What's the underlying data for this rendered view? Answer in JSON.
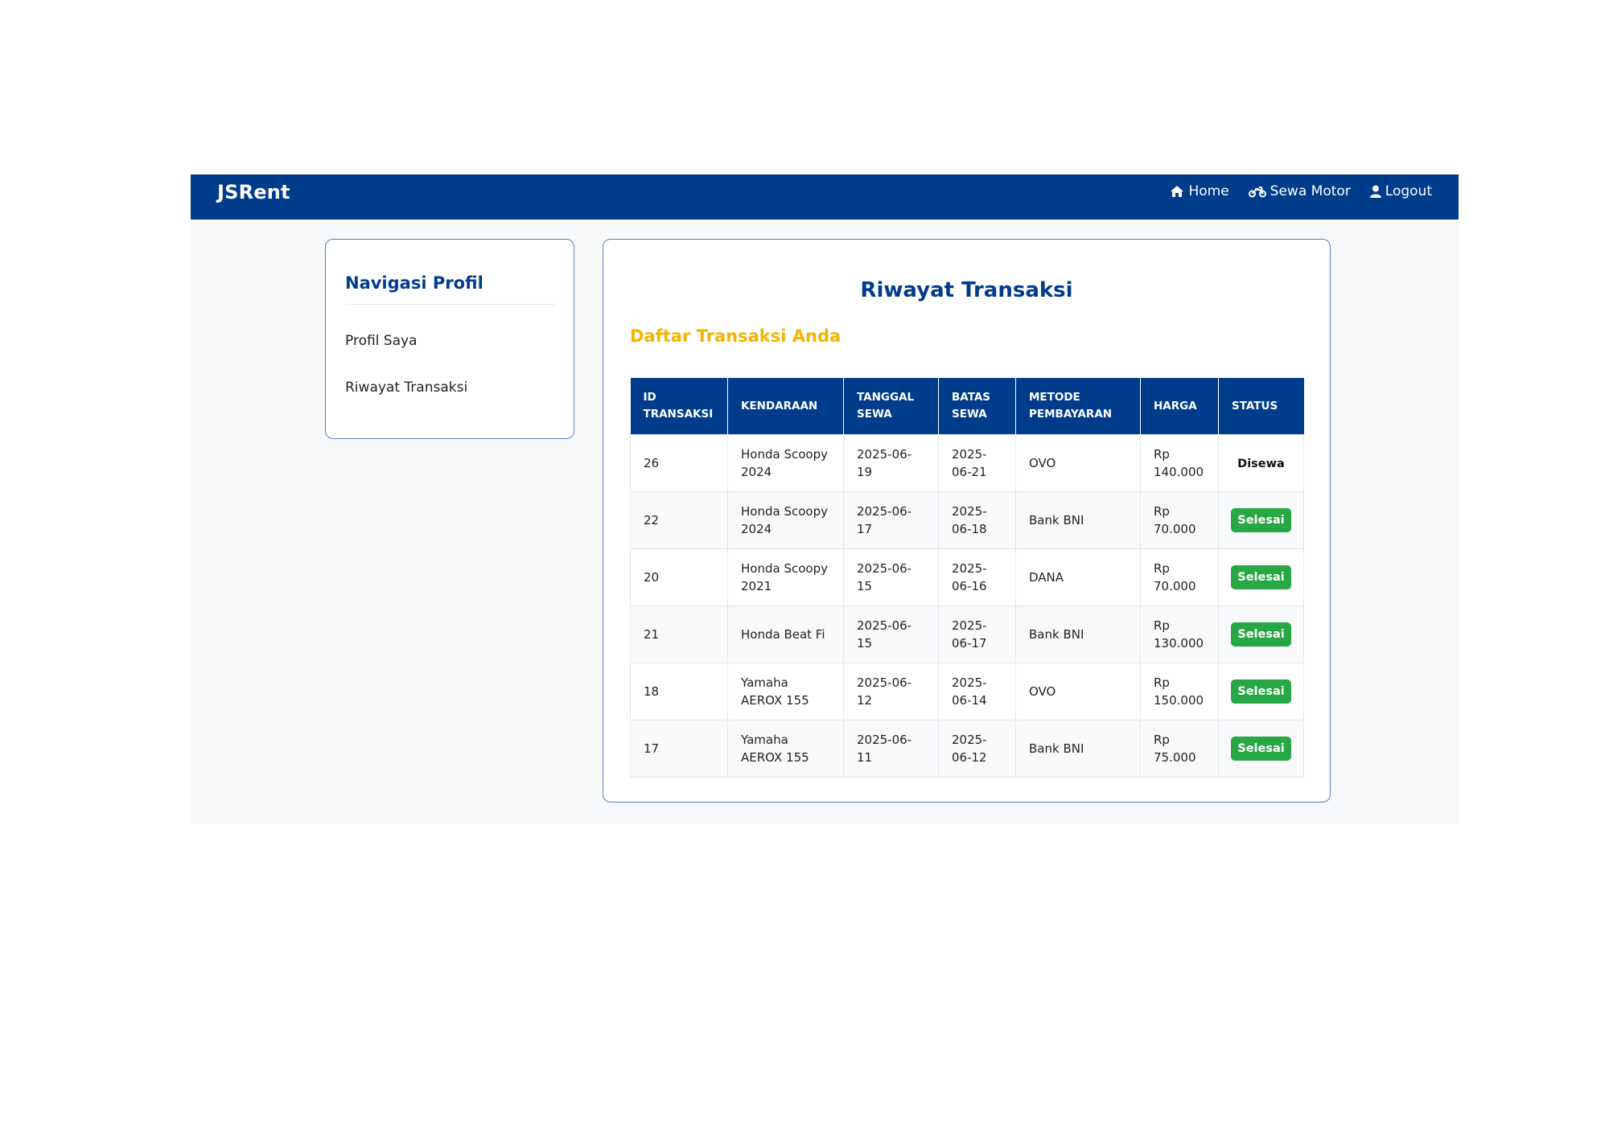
{
  "app": {
    "brand": "JSRent"
  },
  "nav": {
    "links": [
      {
        "label": "Home",
        "icon": "home-icon"
      },
      {
        "label": "Sewa Motor",
        "icon": "motorcycle-icon"
      },
      {
        "label": "Logout",
        "icon": "user-icon"
      }
    ]
  },
  "sidebar": {
    "title": "Navigasi Profil",
    "items": [
      {
        "label": "Profil Saya"
      },
      {
        "label": "Riwayat Transaksi"
      }
    ]
  },
  "main": {
    "title": "Riwayat Transaksi",
    "subtitle": "Daftar Transaksi Anda"
  },
  "table": {
    "headers": [
      "ID TRANSAKSI",
      "KENDARAAN",
      "TANGGAL SEWA",
      "BATAS SEWA",
      "METODE PEMBAYARAN",
      "HARGA",
      "STATUS"
    ],
    "rows": [
      {
        "id": "26",
        "vehicle": "Honda Scoopy 2024",
        "start": "2025-06-19",
        "end": "2025-06-21",
        "method": "OVO",
        "price": "Rp 140.000",
        "status": "Disewa"
      },
      {
        "id": "22",
        "vehicle": "Honda Scoopy 2024",
        "start": "2025-06-17",
        "end": "2025-06-18",
        "method": "Bank BNI",
        "price": "Rp 70.000",
        "status": "Selesai"
      },
      {
        "id": "20",
        "vehicle": "Honda Scoopy 2021",
        "start": "2025-06-15",
        "end": "2025-06-16",
        "method": "DANA",
        "price": "Rp 70.000",
        "status": "Selesai"
      },
      {
        "id": "21",
        "vehicle": "Honda Beat Fi",
        "start": "2025-06-15",
        "end": "2025-06-17",
        "method": "Bank BNI",
        "price": "Rp 130.000",
        "status": "Selesai"
      },
      {
        "id": "18",
        "vehicle": "Yamaha AEROX 155",
        "start": "2025-06-12",
        "end": "2025-06-14",
        "method": "OVO",
        "price": "Rp 150.000",
        "status": "Selesai"
      },
      {
        "id": "17",
        "vehicle": "Yamaha AEROX 155",
        "start": "2025-06-11",
        "end": "2025-06-12",
        "method": "Bank BNI",
        "price": "Rp 75.000",
        "status": "Selesai"
      }
    ]
  },
  "colors": {
    "primary": "#003c8c",
    "accent": "#f4b400",
    "success": "#28a745"
  }
}
